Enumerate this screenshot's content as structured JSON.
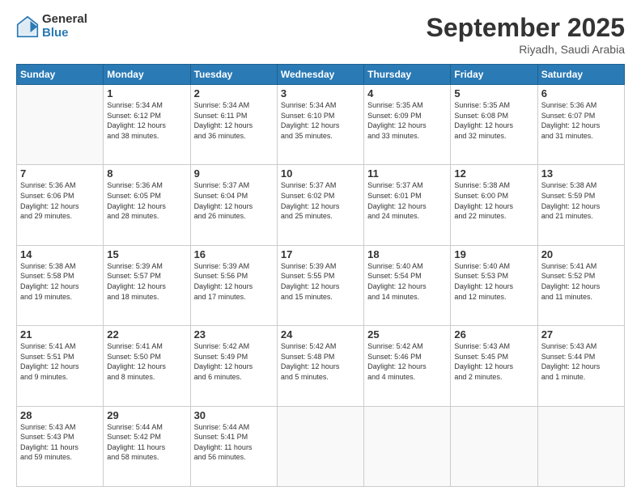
{
  "logo": {
    "general": "General",
    "blue": "Blue"
  },
  "header": {
    "month": "September 2025",
    "location": "Riyadh, Saudi Arabia"
  },
  "weekdays": [
    "Sunday",
    "Monday",
    "Tuesday",
    "Wednesday",
    "Thursday",
    "Friday",
    "Saturday"
  ],
  "weeks": [
    [
      {
        "day": "",
        "info": ""
      },
      {
        "day": "1",
        "info": "Sunrise: 5:34 AM\nSunset: 6:12 PM\nDaylight: 12 hours\nand 38 minutes."
      },
      {
        "day": "2",
        "info": "Sunrise: 5:34 AM\nSunset: 6:11 PM\nDaylight: 12 hours\nand 36 minutes."
      },
      {
        "day": "3",
        "info": "Sunrise: 5:34 AM\nSunset: 6:10 PM\nDaylight: 12 hours\nand 35 minutes."
      },
      {
        "day": "4",
        "info": "Sunrise: 5:35 AM\nSunset: 6:09 PM\nDaylight: 12 hours\nand 33 minutes."
      },
      {
        "day": "5",
        "info": "Sunrise: 5:35 AM\nSunset: 6:08 PM\nDaylight: 12 hours\nand 32 minutes."
      },
      {
        "day": "6",
        "info": "Sunrise: 5:36 AM\nSunset: 6:07 PM\nDaylight: 12 hours\nand 31 minutes."
      }
    ],
    [
      {
        "day": "7",
        "info": "Sunrise: 5:36 AM\nSunset: 6:06 PM\nDaylight: 12 hours\nand 29 minutes."
      },
      {
        "day": "8",
        "info": "Sunrise: 5:36 AM\nSunset: 6:05 PM\nDaylight: 12 hours\nand 28 minutes."
      },
      {
        "day": "9",
        "info": "Sunrise: 5:37 AM\nSunset: 6:04 PM\nDaylight: 12 hours\nand 26 minutes."
      },
      {
        "day": "10",
        "info": "Sunrise: 5:37 AM\nSunset: 6:02 PM\nDaylight: 12 hours\nand 25 minutes."
      },
      {
        "day": "11",
        "info": "Sunrise: 5:37 AM\nSunset: 6:01 PM\nDaylight: 12 hours\nand 24 minutes."
      },
      {
        "day": "12",
        "info": "Sunrise: 5:38 AM\nSunset: 6:00 PM\nDaylight: 12 hours\nand 22 minutes."
      },
      {
        "day": "13",
        "info": "Sunrise: 5:38 AM\nSunset: 5:59 PM\nDaylight: 12 hours\nand 21 minutes."
      }
    ],
    [
      {
        "day": "14",
        "info": "Sunrise: 5:38 AM\nSunset: 5:58 PM\nDaylight: 12 hours\nand 19 minutes."
      },
      {
        "day": "15",
        "info": "Sunrise: 5:39 AM\nSunset: 5:57 PM\nDaylight: 12 hours\nand 18 minutes."
      },
      {
        "day": "16",
        "info": "Sunrise: 5:39 AM\nSunset: 5:56 PM\nDaylight: 12 hours\nand 17 minutes."
      },
      {
        "day": "17",
        "info": "Sunrise: 5:39 AM\nSunset: 5:55 PM\nDaylight: 12 hours\nand 15 minutes."
      },
      {
        "day": "18",
        "info": "Sunrise: 5:40 AM\nSunset: 5:54 PM\nDaylight: 12 hours\nand 14 minutes."
      },
      {
        "day": "19",
        "info": "Sunrise: 5:40 AM\nSunset: 5:53 PM\nDaylight: 12 hours\nand 12 minutes."
      },
      {
        "day": "20",
        "info": "Sunrise: 5:41 AM\nSunset: 5:52 PM\nDaylight: 12 hours\nand 11 minutes."
      }
    ],
    [
      {
        "day": "21",
        "info": "Sunrise: 5:41 AM\nSunset: 5:51 PM\nDaylight: 12 hours\nand 9 minutes."
      },
      {
        "day": "22",
        "info": "Sunrise: 5:41 AM\nSunset: 5:50 PM\nDaylight: 12 hours\nand 8 minutes."
      },
      {
        "day": "23",
        "info": "Sunrise: 5:42 AM\nSunset: 5:49 PM\nDaylight: 12 hours\nand 6 minutes."
      },
      {
        "day": "24",
        "info": "Sunrise: 5:42 AM\nSunset: 5:48 PM\nDaylight: 12 hours\nand 5 minutes."
      },
      {
        "day": "25",
        "info": "Sunrise: 5:42 AM\nSunset: 5:46 PM\nDaylight: 12 hours\nand 4 minutes."
      },
      {
        "day": "26",
        "info": "Sunrise: 5:43 AM\nSunset: 5:45 PM\nDaylight: 12 hours\nand 2 minutes."
      },
      {
        "day": "27",
        "info": "Sunrise: 5:43 AM\nSunset: 5:44 PM\nDaylight: 12 hours\nand 1 minute."
      }
    ],
    [
      {
        "day": "28",
        "info": "Sunrise: 5:43 AM\nSunset: 5:43 PM\nDaylight: 11 hours\nand 59 minutes."
      },
      {
        "day": "29",
        "info": "Sunrise: 5:44 AM\nSunset: 5:42 PM\nDaylight: 11 hours\nand 58 minutes."
      },
      {
        "day": "30",
        "info": "Sunrise: 5:44 AM\nSunset: 5:41 PM\nDaylight: 11 hours\nand 56 minutes."
      },
      {
        "day": "",
        "info": ""
      },
      {
        "day": "",
        "info": ""
      },
      {
        "day": "",
        "info": ""
      },
      {
        "day": "",
        "info": ""
      }
    ]
  ]
}
